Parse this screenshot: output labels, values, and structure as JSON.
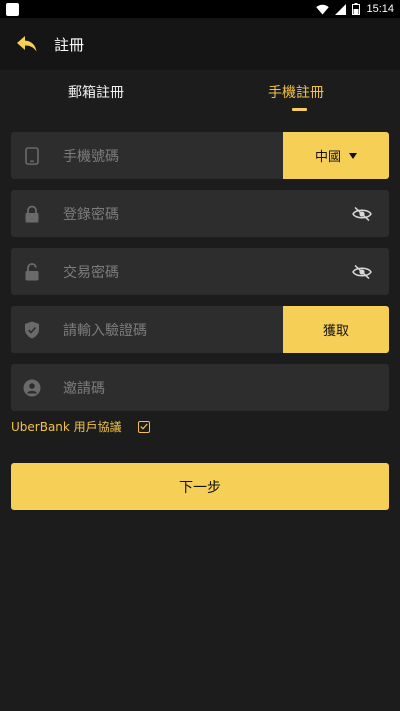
{
  "status_bar": {
    "time": "15:14"
  },
  "header": {
    "title": "註冊",
    "back_icon": "back-arrow-icon"
  },
  "tabs": [
    {
      "label": "郵箱註冊",
      "active": false
    },
    {
      "label": "手機註冊",
      "active": true
    }
  ],
  "form": {
    "phone": {
      "placeholder": "手機號碼",
      "country_label": "中國",
      "icon": "phone-icon"
    },
    "login_password": {
      "placeholder": "登錄密碼",
      "icon": "lock-icon"
    },
    "trade_password": {
      "placeholder": "交易密碼",
      "icon": "unlock-icon"
    },
    "captcha": {
      "placeholder": "請輸入驗證碼",
      "button_label": "獲取",
      "icon": "shield-icon"
    },
    "invite_code": {
      "placeholder": "邀請碼",
      "icon": "user-icon"
    }
  },
  "agreement": {
    "label": "UberBank 用戶協議",
    "checked": true
  },
  "next_button": {
    "label": "下一步"
  },
  "colors": {
    "accent": "#f6cf57",
    "background": "#1c1c1c",
    "field": "#2d2d2d",
    "header": "#151515"
  }
}
